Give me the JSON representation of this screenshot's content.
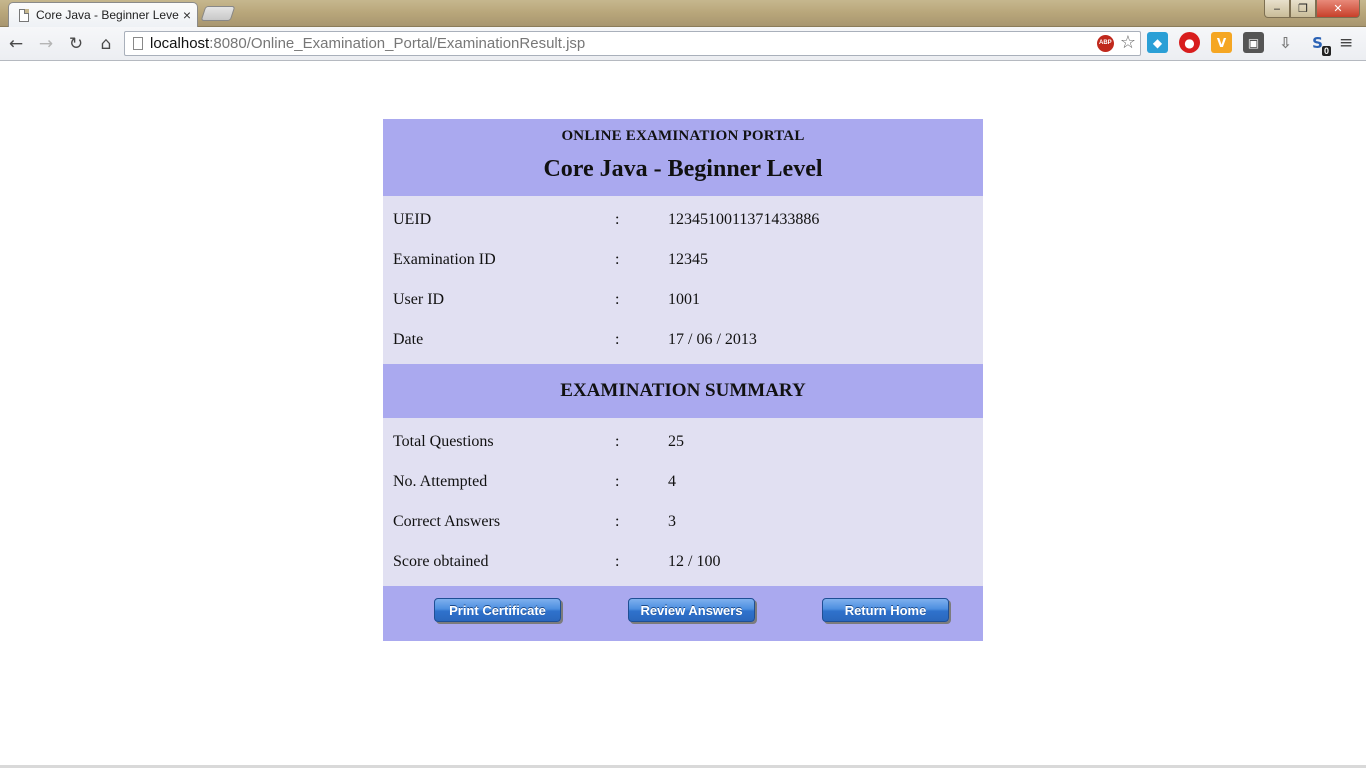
{
  "browser": {
    "tab_title": "Core Java - Beginner Level",
    "tab_close": "×",
    "url_host": "localhost",
    "url_rest": ":8080/Online_Examination_Portal/ExaminationResult.jsp",
    "abp_label": "ABP",
    "icons": {
      "back": "back-arrow-icon",
      "forward": "forward-arrow-icon",
      "reload": "reload-icon",
      "home": "home-icon",
      "star": "bookmark-star-icon",
      "menu": "chrome-menu-icon"
    },
    "extension_badge": "0"
  },
  "page": {
    "portal_title": "ONLINE EXAMINATION PORTAL",
    "exam_title": "Core Java - Beginner Level",
    "separator": ":",
    "details": [
      {
        "label": "UEID",
        "value": "1234510011371433886"
      },
      {
        "label": "Examination ID",
        "value": "12345"
      },
      {
        "label": "User ID",
        "value": "1001"
      },
      {
        "label": "Date",
        "value": "17 / 06 / 2013"
      }
    ],
    "summary_title": "EXAMINATION SUMMARY",
    "summary": [
      {
        "label": "Total Questions",
        "value": "25"
      },
      {
        "label": "No. Attempted",
        "value": "4"
      },
      {
        "label": "Correct Answers",
        "value": "3"
      },
      {
        "label": "Score obtained",
        "value": "12 / 100"
      }
    ],
    "buttons": {
      "print": "Print Certificate",
      "review": "Review Answers",
      "home": "Return Home"
    }
  },
  "colors": {
    "band": "#aaa9ef",
    "rows_bg": "#e1e0f2",
    "button": "#3a7fd8"
  }
}
